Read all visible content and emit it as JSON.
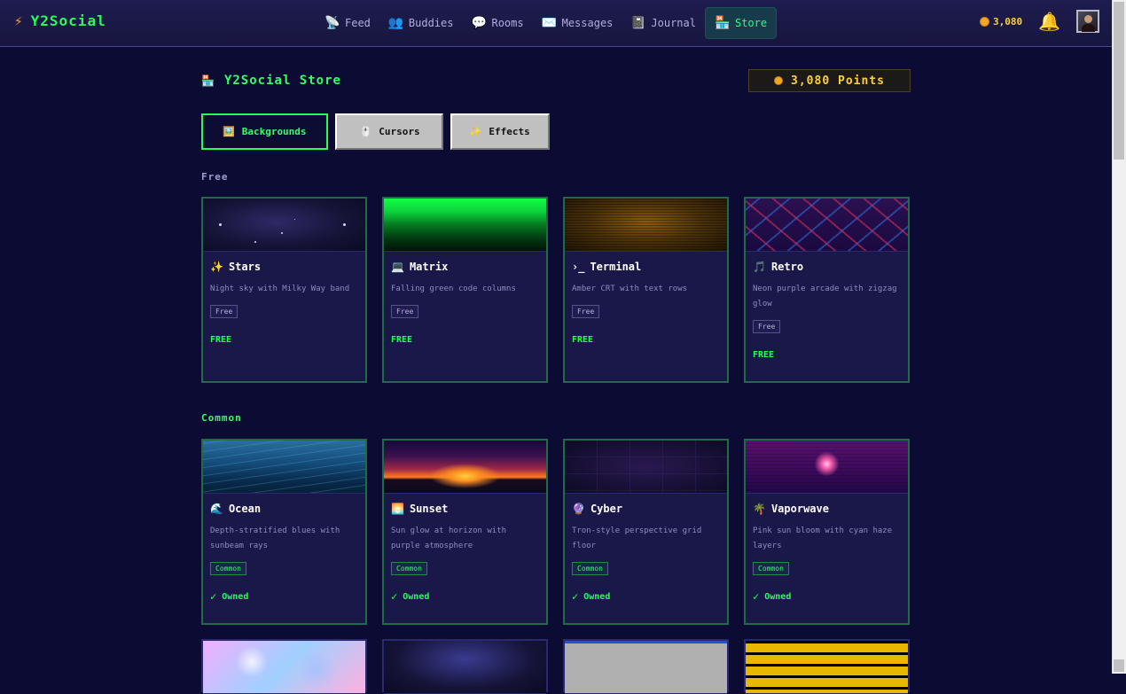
{
  "nav": {
    "brand": "Y2Social",
    "links": [
      {
        "label": "Feed",
        "icon": "satellite-icon"
      },
      {
        "label": "Buddies",
        "icon": "buddies-icon"
      },
      {
        "label": "Rooms",
        "icon": "chat-bubble-icon"
      },
      {
        "label": "Messages",
        "icon": "envelope-icon"
      },
      {
        "label": "Journal",
        "icon": "notebook-icon"
      },
      {
        "label": "Store",
        "icon": "store-icon",
        "active": true
      }
    ],
    "coins": "3,080"
  },
  "store": {
    "title": "Y2Social Store",
    "points": "3,080 Points"
  },
  "tabs": [
    {
      "label": "Backgrounds",
      "icon": "picture-icon",
      "active": true
    },
    {
      "label": "Cursors",
      "icon": "mouse-icon"
    },
    {
      "label": "Effects",
      "icon": "sparkles-icon"
    }
  ],
  "sections": {
    "free": {
      "title": "Free",
      "color": "#9f9dcf",
      "items": [
        {
          "name": "Stars",
          "icon": "✨",
          "desc": "Night sky with Milky Way band",
          "badge": "Free",
          "price": "FREE"
        },
        {
          "name": "Matrix",
          "icon": "💻",
          "desc": "Falling green code columns",
          "badge": "Free",
          "price": "FREE"
        },
        {
          "name": "Terminal",
          "icon": "›_",
          "desc": "Amber CRT with text rows",
          "badge": "Free",
          "price": "FREE"
        },
        {
          "name": "Retro",
          "icon": "🎵",
          "desc": "Neon purple arcade with zigzag glow",
          "badge": "Free",
          "price": "FREE"
        }
      ]
    },
    "common": {
      "title": "Common",
      "color": "#33ff66",
      "items": [
        {
          "name": "Ocean",
          "icon": "🌊",
          "desc": "Depth-stratified blues with sunbeam rays",
          "badge": "Common",
          "status": "Owned"
        },
        {
          "name": "Sunset",
          "icon": "🌅",
          "desc": "Sun glow at horizon with purple atmosphere",
          "badge": "Common",
          "status": "Owned"
        },
        {
          "name": "Cyber",
          "icon": "🔮",
          "desc": "Tron-style perspective grid floor",
          "badge": "Common",
          "status": "Owned"
        },
        {
          "name": "Vaporwave",
          "icon": "🌴",
          "desc": "Pink sun bloom with cyan haze layers",
          "badge": "Common",
          "status": "Owned"
        }
      ]
    }
  },
  "check_mark": "✓"
}
